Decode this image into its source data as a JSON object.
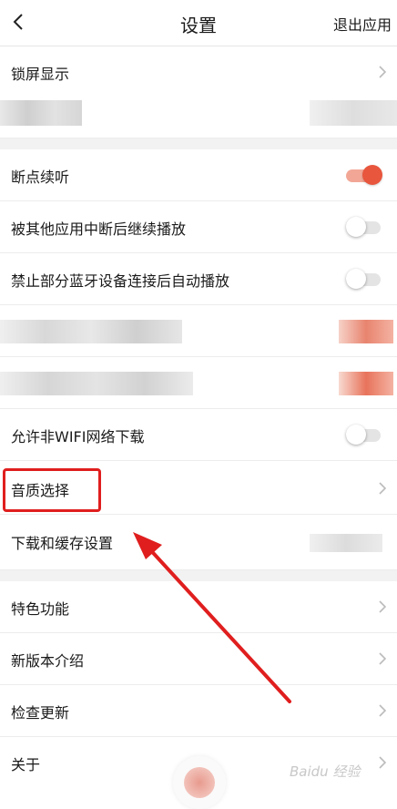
{
  "header": {
    "title": "设置",
    "exit_label": "退出应用"
  },
  "rows": [
    {
      "label": "锁屏显示"
    },
    {
      "label": "断点续听"
    },
    {
      "label": "被其他应用中断后继续播放"
    },
    {
      "label": "禁止部分蓝牙设备连接后自动播放"
    },
    {
      "label": "允许非WIFI网络下载"
    },
    {
      "label": "音质选择"
    },
    {
      "label": "下载和缓存设置"
    },
    {
      "label": "特色功能"
    },
    {
      "label": "新版本介绍"
    },
    {
      "label": "检查更新"
    },
    {
      "label": "关于"
    }
  ],
  "toggles": {
    "resume_play": true,
    "continue_after_interrupt": false,
    "block_bt_autoplay": false,
    "allow_non_wifi_download": false
  },
  "colors": {
    "accent": "#e8563d",
    "annotation_red": "#e01e1e"
  },
  "watermark": "Baidu 经验"
}
